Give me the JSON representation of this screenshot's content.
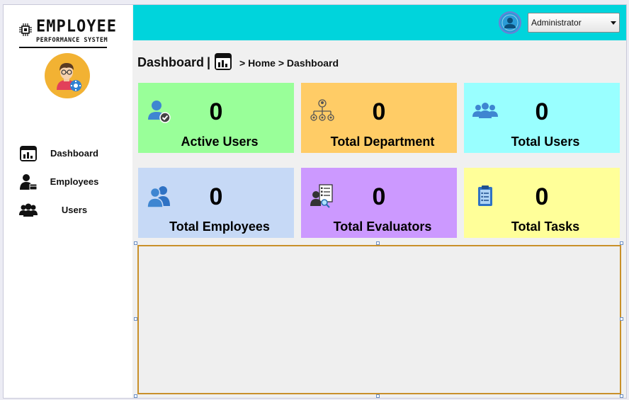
{
  "app": {
    "logo_title": "EMPLOYEE",
    "logo_subtitle": "PERFORMANCE SYSTEM"
  },
  "sidebar": {
    "items": [
      {
        "label": "Dashboard",
        "icon": "dashboard-icon"
      },
      {
        "label": "Employees",
        "icon": "employee-icon"
      },
      {
        "label": "Users",
        "icon": "users-icon"
      }
    ]
  },
  "header": {
    "role_select_value": "Administrator"
  },
  "breadcrumb": {
    "title": "Dashboard",
    "separator": "|",
    "path": "> Home > Dashboard"
  },
  "cards": [
    {
      "label": "Active Users",
      "value": "0",
      "color": "#99ff99",
      "icon": "active-user-icon"
    },
    {
      "label": "Total Department",
      "value": "0",
      "color": "#ffcc66",
      "icon": "department-icon"
    },
    {
      "label": "Total Users",
      "value": "0",
      "color": "#99ffff",
      "icon": "users-group-icon"
    },
    {
      "label": "Total Employees",
      "value": "0",
      "color": "#c6d9f6",
      "icon": "employees-icon"
    },
    {
      "label": "Total Evaluators",
      "value": "0",
      "color": "#cc99ff",
      "icon": "evaluator-icon"
    },
    {
      "label": "Total Tasks",
      "value": "0",
      "color": "#ffff99",
      "icon": "tasks-icon"
    }
  ],
  "colors": {
    "topbar": "#00d4dc",
    "panel_border": "#c9902a"
  }
}
